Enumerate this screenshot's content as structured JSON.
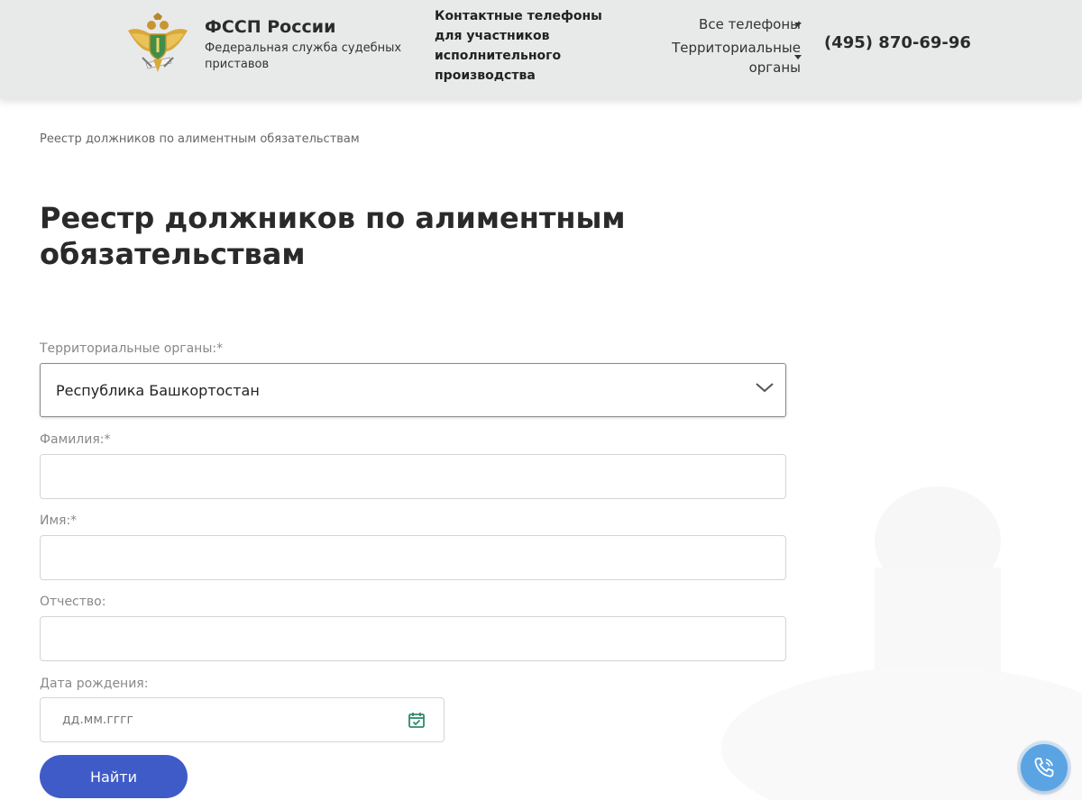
{
  "header": {
    "brand_title": "ФССП России",
    "brand_subtitle": "Федеральная служба судебных приставов",
    "contacts_text": "Контактные телефоны для участников исполнительного производства",
    "nav_all_phones": "Все телефоны",
    "nav_territorial": "Территориальные органы",
    "phone": "(495) 870-69-96"
  },
  "breadcrumb": "Реестр должников по алиментным обязательствам",
  "page_title": "Реестр должников по алиментным обязательствам",
  "form": {
    "territorial_label": "Территориальные органы:*",
    "territorial_value": "Республика Башкортостан",
    "surname_label": "Фамилия:*",
    "surname_value": "",
    "name_label": "Имя:*",
    "name_value": "",
    "patronymic_label": "Отчество:",
    "patronymic_value": "",
    "birthdate_label": "Дата рождения:",
    "birthdate_placeholder": "дд.мм.гггг",
    "submit_label": "Найти"
  },
  "icons": {
    "logo": "fssp-emblem-icon",
    "select_arrow": "chevron-down-icon",
    "calendar": "calendar-check-icon",
    "call": "phone-call-icon"
  },
  "colors": {
    "header_bg": "#e8e9e9",
    "button_bg": "#3f5bc8",
    "call_button_bg": "#5aa4e4",
    "calendar_icon": "#2e8b6a"
  }
}
